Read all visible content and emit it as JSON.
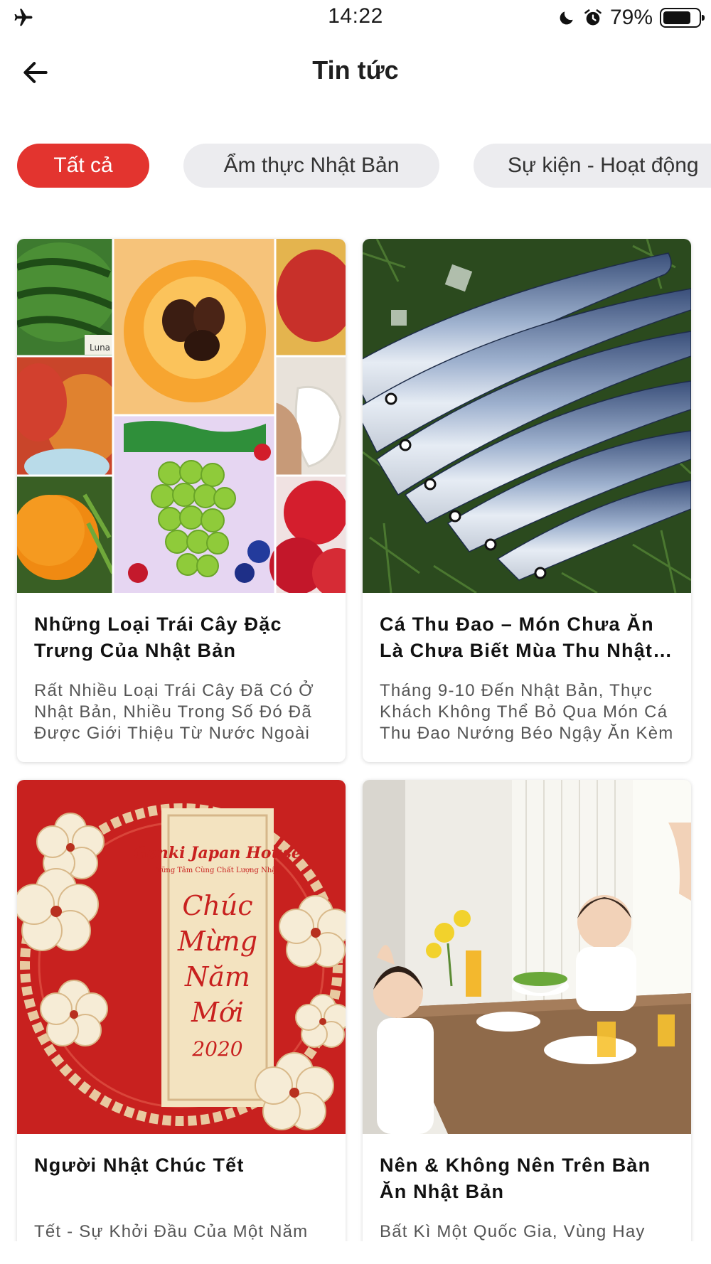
{
  "status_bar": {
    "time": "14:22",
    "battery_percent": "79%",
    "battery_level": 0.79,
    "icons": [
      "airplane-icon",
      "moon-icon",
      "alarm-icon",
      "battery-icon"
    ]
  },
  "header": {
    "title": "Tin tức",
    "back_icon": "arrow-left-icon"
  },
  "tabs": [
    {
      "label": "Tất cả",
      "active": true
    },
    {
      "label": "Ẩm thực Nhật Bản",
      "active": false
    },
    {
      "label": "Sự kiện - Hoạt động",
      "active": false
    }
  ],
  "colors": {
    "accent": "#e3342f",
    "tab_inactive_bg": "#ececef",
    "card_shadow": "#d9d9d9"
  },
  "articles": [
    {
      "title": "Những Loại Trái Cây Đặc Trưng Của Nhật Bản",
      "description": "Rất Nhiều Loại Trái Cây Đã Có Ở Nhật Bản, Nhiều Trong Số Đó Đã Được Giới Thiệu Từ Nước Ngoài"
    },
    {
      "title": "Cá Thu Đao – Món Chưa Ăn Là Chưa Biết Mùa Thu Nhật Bản",
      "description": "Tháng 9-10 Đến Nhật Bản, Thực Khách Không Thể Bỏ Qua Món Cá Thu Đao Nướng Béo Ngậy Ăn Kèm"
    },
    {
      "title": "Người Nhật Chúc Tết",
      "description": "Tết - Sự Khởi Đầu Của Một Năm Mới Là Khoảng Thời Gian Mọi"
    },
    {
      "title": "Nên & Không Nên Trên Bàn Ăn Nhật Bản",
      "description": "Bất Kì Một Quốc Gia, Vùng Hay Văn Hóa Nào Cũng Đều Có"
    }
  ],
  "images": {
    "card3_brand": "Genki Japan House",
    "card3_tagline": "Vững Tâm Cùng Chất Lượng Nhật",
    "card3_greeting_1": "Chúc",
    "card3_greeting_2": "Mừng",
    "card3_greeting_3": "Năm",
    "card3_greeting_4": "Mới",
    "card3_year": "2020",
    "card1_label": "Luna"
  }
}
